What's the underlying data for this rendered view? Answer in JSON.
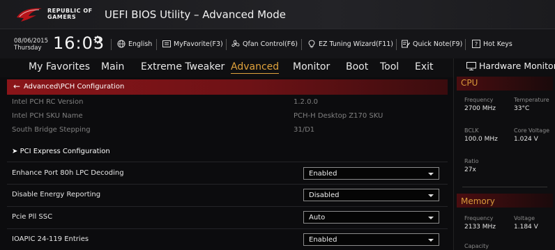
{
  "titlebar": {
    "brand_line1": "REPUBLIC OF",
    "brand_line2": "GAMERS",
    "title": "UEFI BIOS Utility – Advanced Mode"
  },
  "infobar": {
    "date": "08/06/2015",
    "weekday": "Thursday",
    "time": "16:03",
    "tools": [
      {
        "label": "English",
        "icon": "globe-icon"
      },
      {
        "label": "MyFavorite(F3)",
        "icon": "list-icon"
      },
      {
        "label": "Qfan Control(F6)",
        "icon": "fan-icon"
      },
      {
        "label": "EZ Tuning Wizard(F11)",
        "icon": "bulb-icon"
      },
      {
        "label": "Quick Note(F9)",
        "icon": "note-icon"
      },
      {
        "label": "Hot Keys",
        "icon": "help-icon"
      }
    ]
  },
  "menu": {
    "items": [
      "My Favorites",
      "Main",
      "Extreme Tweaker",
      "Advanced",
      "Monitor",
      "Boot",
      "Tool",
      "Exit"
    ],
    "active": "Advanced"
  },
  "breadcrumb": "Advanced\\PCH Configuration",
  "info_rows": [
    {
      "label": "Intel PCH RC Version",
      "value": "1.2.0.0"
    },
    {
      "label": "Intel PCH SKU Name",
      "value": "PCH-H Desktop Z170 SKU"
    },
    {
      "label": "South Bridge Stepping",
      "value": "31/D1"
    }
  ],
  "submenu": {
    "label": "PCI Express Configuration"
  },
  "settings": [
    {
      "label": "Enhance Port 80h LPC Decoding",
      "value": "Enabled"
    },
    {
      "label": "Disable Energy Reporting",
      "value": "Disabled"
    },
    {
      "label": "Pcie Pll SSC",
      "value": "Auto"
    },
    {
      "label": "IOAPIC 24-119 Entries",
      "value": "Enabled"
    }
  ],
  "hwmon": {
    "title": "Hardware Monitor",
    "cpu": {
      "section": "CPU",
      "frequency_label": "Frequency",
      "frequency": "2700 MHz",
      "temperature_label": "Temperature",
      "temperature": "33°C",
      "bclk_label": "BCLK",
      "bclk": "100.0 MHz",
      "core_voltage_label": "Core Voltage",
      "core_voltage": "1.024 V",
      "ratio_label": "Ratio",
      "ratio": "27x"
    },
    "memory": {
      "section": "Memory",
      "frequency_label": "Frequency",
      "frequency": "2133 MHz",
      "voltage_label": "Voltage",
      "voltage": "1.184 V",
      "capacity_label": "Capacity"
    }
  },
  "colors": {
    "accent": "#e0a23c",
    "breadcrumb_red": "#8a1519",
    "background": "#0c0c0e"
  }
}
